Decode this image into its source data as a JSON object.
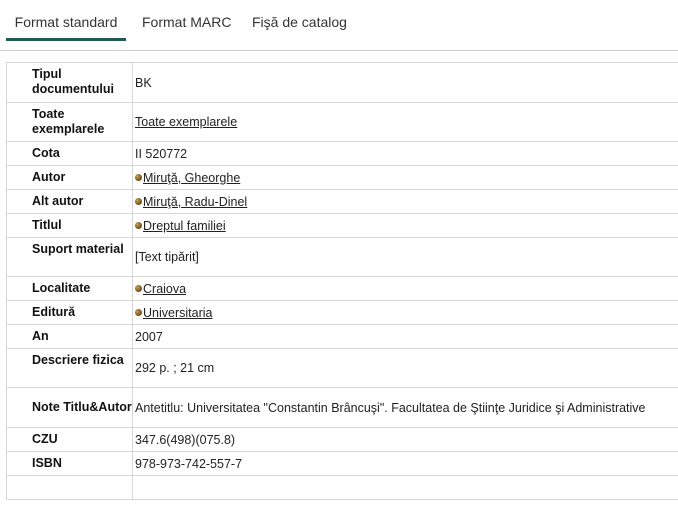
{
  "tabs": [
    {
      "label": "Format standard",
      "active": true
    },
    {
      "label": "Format MARC",
      "active": false
    },
    {
      "label": "Fişă de catalog",
      "active": false
    }
  ],
  "record": {
    "tipul": {
      "label": "Tipul documentului",
      "value": "BK"
    },
    "exemplare": {
      "label": "Toate exemplarele",
      "value": "Toate exemplarele"
    },
    "cota": {
      "label": "Cota",
      "value": "II 520772"
    },
    "autor": {
      "label": "Autor",
      "value": "Miruţă, Gheorghe"
    },
    "alt_autor": {
      "label": "Alt autor",
      "value": "Miruţă, Radu-Dinel"
    },
    "titlul": {
      "label": "Titlul",
      "value": "Dreptul familiei"
    },
    "suport": {
      "label": "Suport material",
      "value": "[Text tipărit]"
    },
    "localitate": {
      "label": "Localitate",
      "value": "Craiova"
    },
    "editura": {
      "label": "Editură",
      "value": "Universitaria"
    },
    "an": {
      "label": "An",
      "value": "2007"
    },
    "descriere": {
      "label": "Descriere fizica",
      "value": "292 p. ; 21 cm"
    },
    "note": {
      "label": "Note Titlu&Autor",
      "value": "Antetitlu: Universitatea \"Constantin Brâncuşi\". Facultatea de Ştiinţe Juridice şi Administrative"
    },
    "czu": {
      "label": "CZU",
      "value": "347.6(498)(075.8)"
    },
    "isbn": {
      "label": "ISBN",
      "value": "978-973-742-557-7"
    }
  }
}
